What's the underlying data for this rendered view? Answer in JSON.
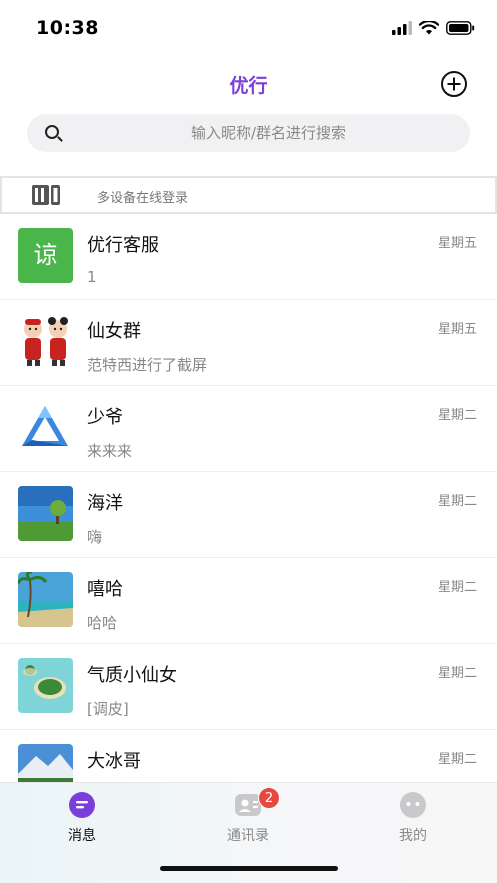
{
  "status_bar": {
    "time": "10:38"
  },
  "header": {
    "title": "优行",
    "accent_color": "#7b3fd9"
  },
  "search": {
    "placeholder": "输入昵称/群名进行搜索"
  },
  "device_banner": {
    "text": "多设备在线登录"
  },
  "chats": [
    {
      "name": "优行客服",
      "preview": "1",
      "time": "星期五",
      "avatar": "service-logo",
      "avatar_text": "谅"
    },
    {
      "name": "仙女群",
      "preview": "范特西进行了截屏",
      "time": "星期五",
      "avatar": "cartoon-couple"
    },
    {
      "name": "少爷",
      "preview": "来来来",
      "time": "星期二",
      "avatar": "blue-triangle"
    },
    {
      "name": "海洋",
      "preview": "嗨",
      "time": "星期二",
      "avatar": "tree-landscape"
    },
    {
      "name": "嘻哈",
      "preview": "哈哈",
      "time": "星期二",
      "avatar": "beach-palm"
    },
    {
      "name": "气质小仙女",
      "preview": "[调皮]",
      "time": "星期二",
      "avatar": "island"
    },
    {
      "name": "大冰哥",
      "preview": "",
      "time": "星期二",
      "avatar": "mountain"
    }
  ],
  "tabs": [
    {
      "label": "消息",
      "icon": "message-icon",
      "active": true
    },
    {
      "label": "通讯录",
      "icon": "contacts-icon",
      "badge": "2"
    },
    {
      "label": "我的",
      "icon": "profile-icon"
    }
  ]
}
